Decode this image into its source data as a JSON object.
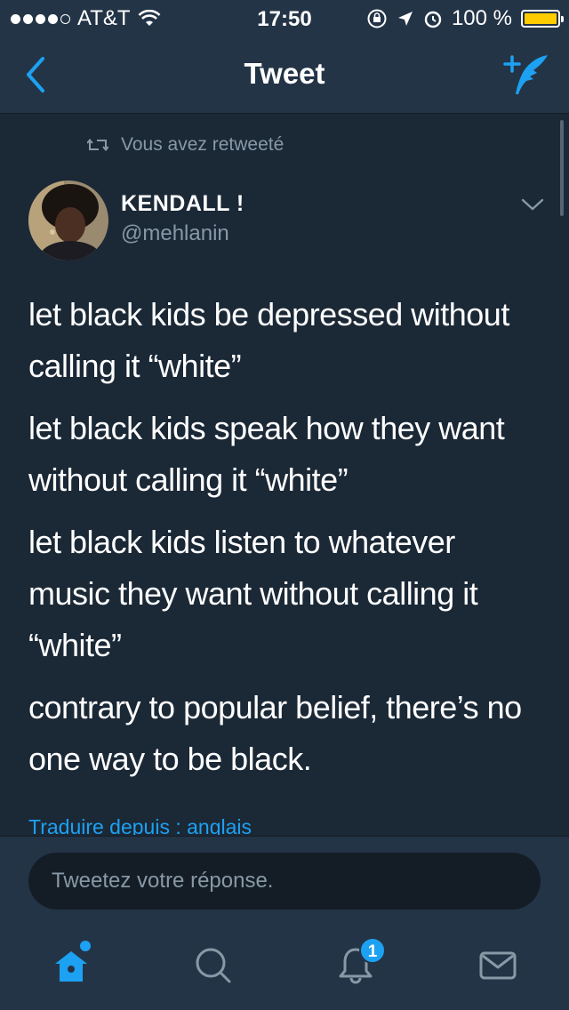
{
  "status_bar": {
    "carrier": "AT&T",
    "time": "17:50",
    "battery_percent": "100 %",
    "signal_bars": 4,
    "colors": {
      "battery": "#ffcc00"
    }
  },
  "nav": {
    "title": "Tweet",
    "back_icon": "chevron-left-icon",
    "compose_icon": "compose-tweet-icon"
  },
  "tweet": {
    "retweet_label": "Vous avez retweeté",
    "author_name": "KENDALL !",
    "author_handle": "@mehlanin",
    "paragraphs": [
      "let black kids be depressed without calling it “white”",
      "let black kids speak how they want without calling it “white”",
      "let black kids listen to whatever music they want without calling it “white”",
      "contrary to popular belief, there’s no one way to be black."
    ],
    "translate_link": "Traduire depuis : anglais"
  },
  "reply": {
    "placeholder": "Tweetez votre réponse."
  },
  "tabs": {
    "items": [
      {
        "name": "home",
        "icon": "home-icon",
        "active": true
      },
      {
        "name": "search",
        "icon": "search-icon",
        "active": false
      },
      {
        "name": "notifications",
        "icon": "bell-icon",
        "active": false
      },
      {
        "name": "messages",
        "icon": "envelope-icon",
        "active": false
      }
    ],
    "notifications_badge": "1"
  },
  "colors": {
    "accent": "#1da1f2",
    "background": "#1b2836",
    "bar_background": "#243447",
    "secondary_text": "#8899a6"
  }
}
